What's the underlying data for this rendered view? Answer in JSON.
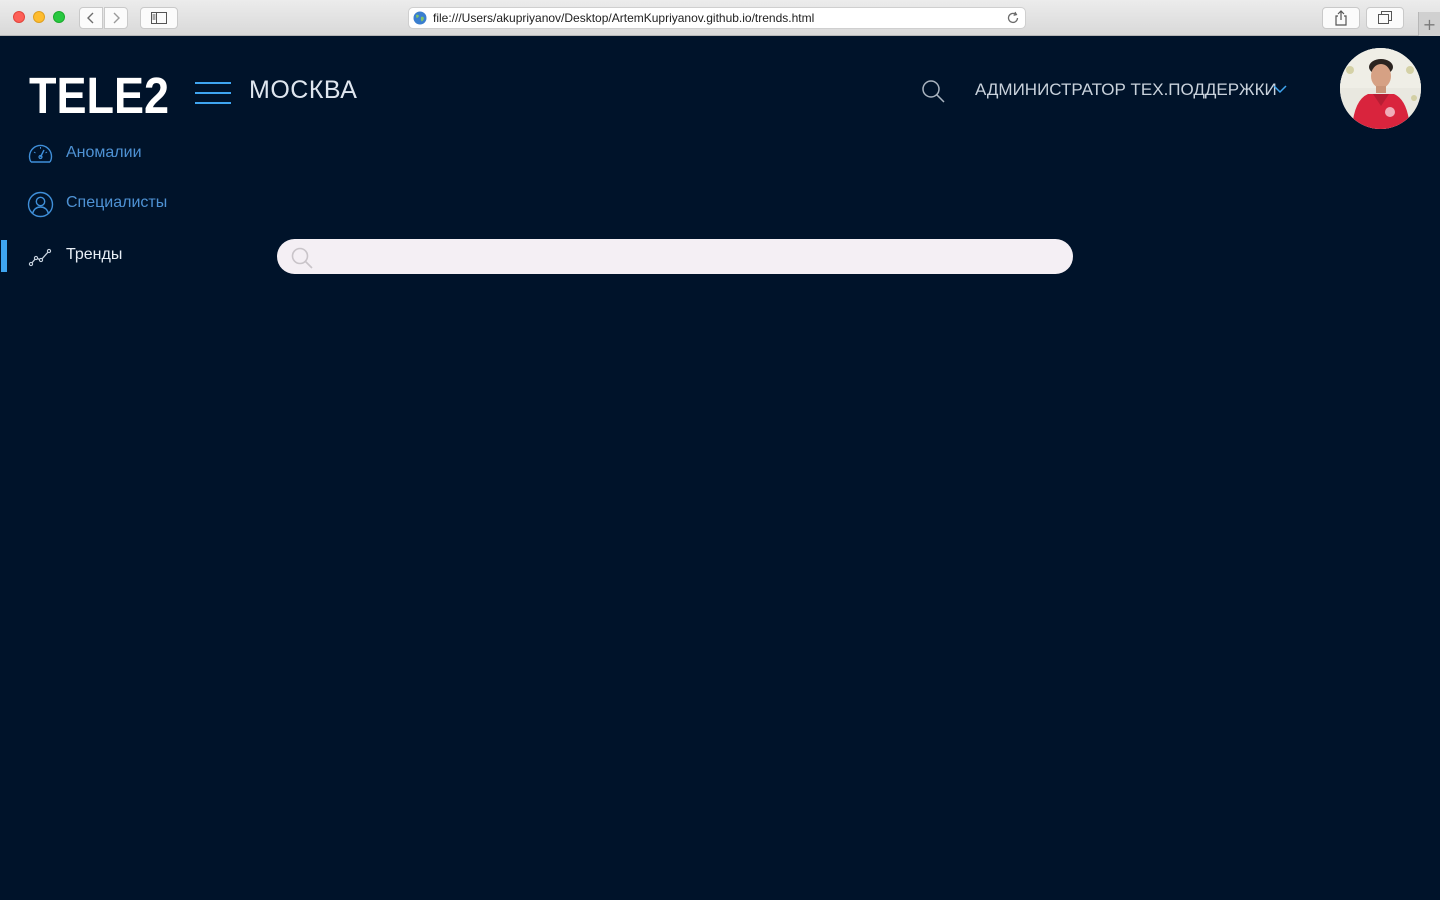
{
  "browser": {
    "url": "file:///Users/akupriyanov/Desktop/ArtemKupriyanov.github.io/trends.html",
    "new_tab_symbol": "+"
  },
  "header": {
    "logo_text": "TELE2",
    "city": "МОСКВА",
    "user_role": "АДМИНИСТРАТОР ТЕХ.ПОДДЕРЖКИ"
  },
  "sidebar": {
    "items": [
      {
        "label": "Аномалии",
        "icon": "speedometer-icon",
        "active": false
      },
      {
        "label": "Специалисты",
        "icon": "user-icon",
        "active": false
      },
      {
        "label": "Тренды",
        "icon": "trend-chart-icon",
        "active": true
      }
    ]
  },
  "search": {
    "value": "",
    "placeholder": ""
  },
  "colors": {
    "background": "#00132a",
    "accent": "#3fa5f0",
    "nav_link": "#4e92d4",
    "search_field": "#f4eff4"
  }
}
